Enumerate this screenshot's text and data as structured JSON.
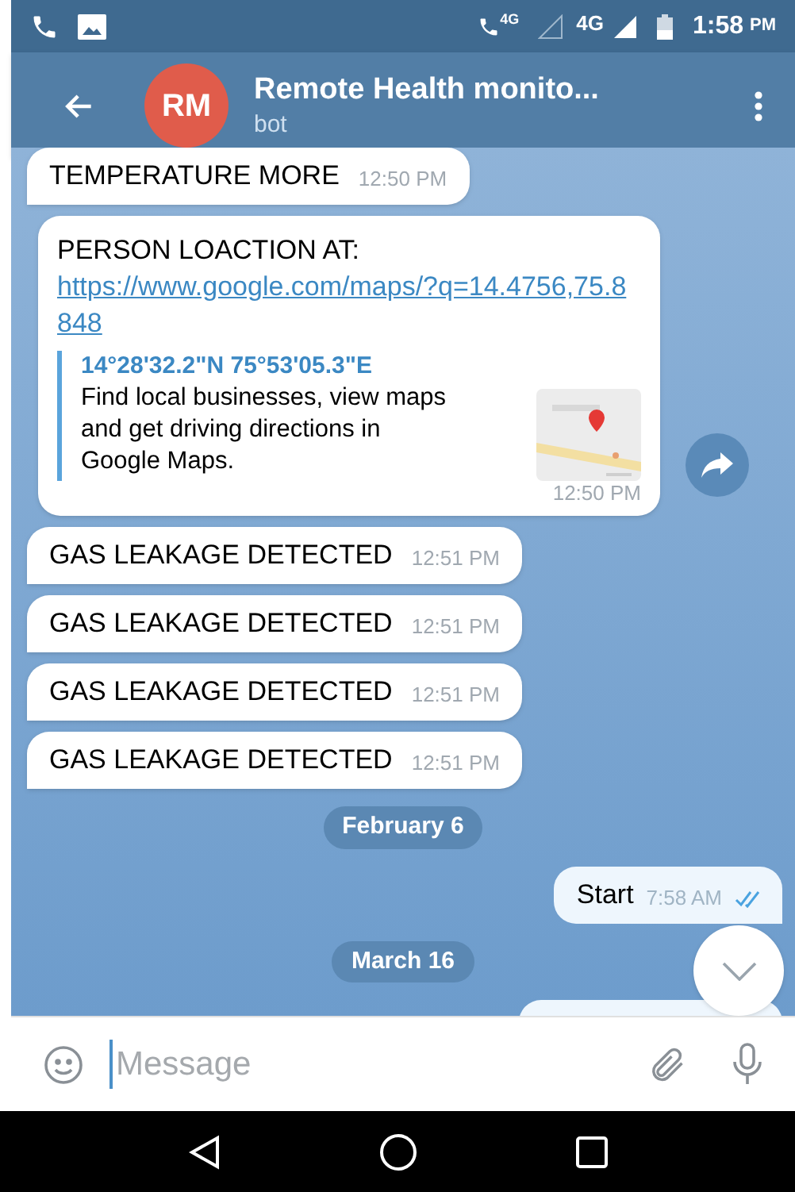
{
  "status_bar": {
    "network_left": "4G",
    "network_right": "4G",
    "time": "1:58",
    "time_suffix": "PM"
  },
  "header": {
    "avatar": "RM",
    "title": "Remote Health monito...",
    "subtitle": "bot"
  },
  "messages": [
    {
      "kind": "incoming",
      "text": "TEMPERATURE MORE",
      "time": "12:50 PM"
    },
    {
      "kind": "location",
      "text": "PERSON LOACTION AT:",
      "link": "https://www.google.com/maps/?q=14.4756,75.8848",
      "preview_title": "14°28'32.2\"N 75°53'05.3\"E",
      "preview_text": "Find local businesses, view maps and get driving directions in Google Maps.",
      "time": "12:50 PM"
    },
    {
      "kind": "incoming",
      "text": "GAS LEAKAGE DETECTED",
      "time": "12:51 PM"
    },
    {
      "kind": "incoming",
      "text": "GAS LEAKAGE DETECTED",
      "time": "12:51 PM"
    },
    {
      "kind": "incoming",
      "text": "GAS LEAKAGE DETECTED",
      "time": "12:51 PM"
    },
    {
      "kind": "incoming",
      "text": "GAS LEAKAGE DETECTED",
      "time": "12:51 PM"
    },
    {
      "kind": "date",
      "text": "February 6"
    },
    {
      "kind": "outgoing",
      "text": "Start",
      "time": "7:58 AM",
      "read": true
    },
    {
      "kind": "date",
      "text": "March 16"
    },
    {
      "kind": "outgoing_cut"
    }
  ],
  "composer": {
    "placeholder": "Message"
  }
}
